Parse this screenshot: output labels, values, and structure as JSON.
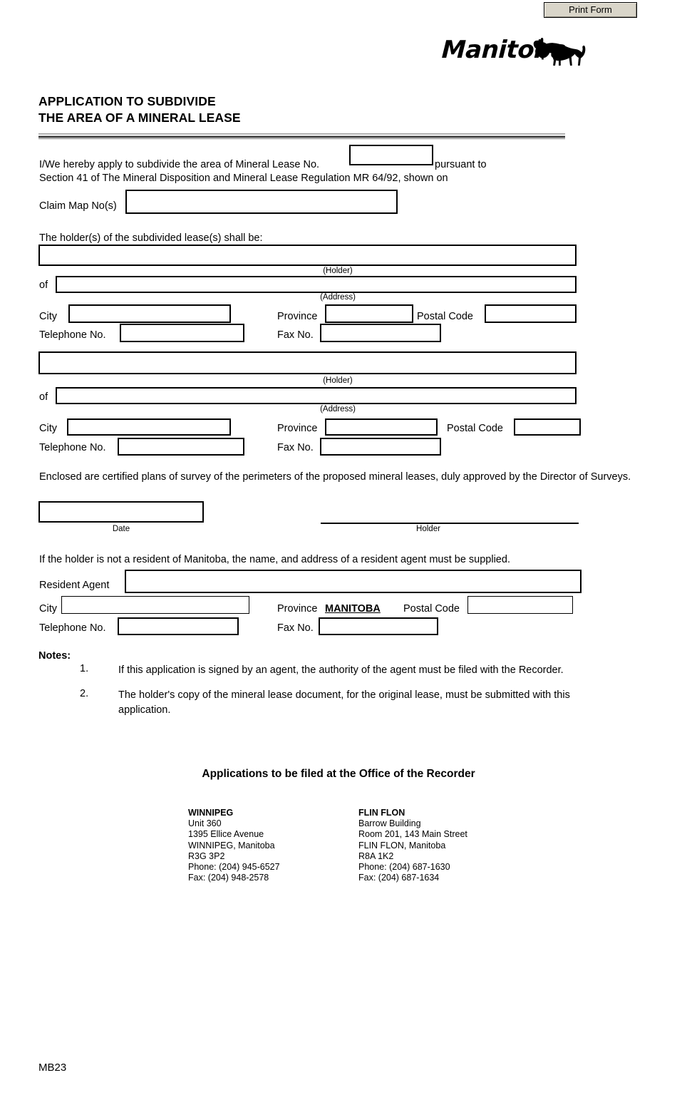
{
  "toolbar": {
    "print_form_label": "Print Form"
  },
  "branding": {
    "wordmark": "Manitoba",
    "bison_icon": "bison-icon"
  },
  "title": {
    "line1": "APPLICATION TO SUBDIVIDE",
    "line2": "THE AREA OF A MINERAL LEASE"
  },
  "intro": {
    "lead": "I/We hereby apply to subdivide the area of Mineral Lease No.",
    "after_lease_no": "pursuant to",
    "line2": "Section 41 of The Mineral Disposition and Mineral Lease Regulation MR 64/92, shown on",
    "claim_map_label": "Claim Map No(s)",
    "lease_no_value": "",
    "claim_map_value": ""
  },
  "holders": {
    "heading": "The holder(s) of the subdivided lease(s) shall be:",
    "caption_holder": "(Holder)",
    "caption_address": "(Address)",
    "of_label": "of",
    "city_label": "City",
    "province_label": "Province",
    "postal_label": "Postal Code",
    "telephone_label": "Telephone No.",
    "fax_label": "Fax No.",
    "entries": [
      {
        "holder_value": "",
        "address_value": "",
        "city_value": "",
        "province_value": "",
        "postal_value": "",
        "telephone_value": "",
        "fax_value": ""
      },
      {
        "holder_value": "",
        "address_value": "",
        "city_value": "",
        "province_value": "",
        "postal_value": "",
        "telephone_value": "",
        "fax_value": ""
      }
    ]
  },
  "survey": {
    "statement": "Enclosed are certified plans of survey of the perimeters of the proposed mineral leases, duly approved by the Director of Surveys.",
    "date_caption": "Date",
    "holder_caption": "Holder",
    "date_value": ""
  },
  "agent": {
    "statement": "If the holder is not a resident of Manitoba, the name, and address of a resident agent must be supplied.",
    "resident_agent_label": "Resident Agent",
    "city_label": "City",
    "province_label": "Province",
    "province_fixed_value": "MANITOBA",
    "postal_label": "Postal Code",
    "telephone_label": "Telephone No.",
    "fax_label": "Fax No.",
    "agent_value": "",
    "city_value": "",
    "postal_value": "",
    "telephone_value": "",
    "fax_value": ""
  },
  "notes": {
    "heading": "Notes:",
    "items": [
      {
        "num": "1.",
        "text": "If this application is signed by an agent, the authority of the agent must be filed with the Recorder."
      },
      {
        "num": "2.",
        "text": "The holder's copy of the mineral lease document, for the original lease, must be submitted with this application."
      }
    ]
  },
  "filing": {
    "heading": "Applications to be filed at the Office of the Recorder",
    "offices": [
      {
        "name": "WINNIPEG",
        "line1": "Unit 360",
        "line2": "1395 Ellice Avenue",
        "line3": "WINNIPEG, Manitoba",
        "line4": "R3G 3P2",
        "phone": "Phone: (204) 945-6527",
        "fax": "Fax: (204) 948-2578"
      },
      {
        "name": "FLIN FLON",
        "line1": "Barrow Building",
        "line2": "Room 201, 143 Main Street",
        "line3": "FLIN FLON, Manitoba",
        "line4": "R8A 1K2",
        "phone": "Phone: (204) 687-1630",
        "fax": "Fax: (204) 687-1634"
      }
    ]
  },
  "footer": {
    "form_code": "MB23"
  },
  "colors": {
    "button_face": "#d9d5c9",
    "text": "#000000",
    "page": "#ffffff"
  }
}
